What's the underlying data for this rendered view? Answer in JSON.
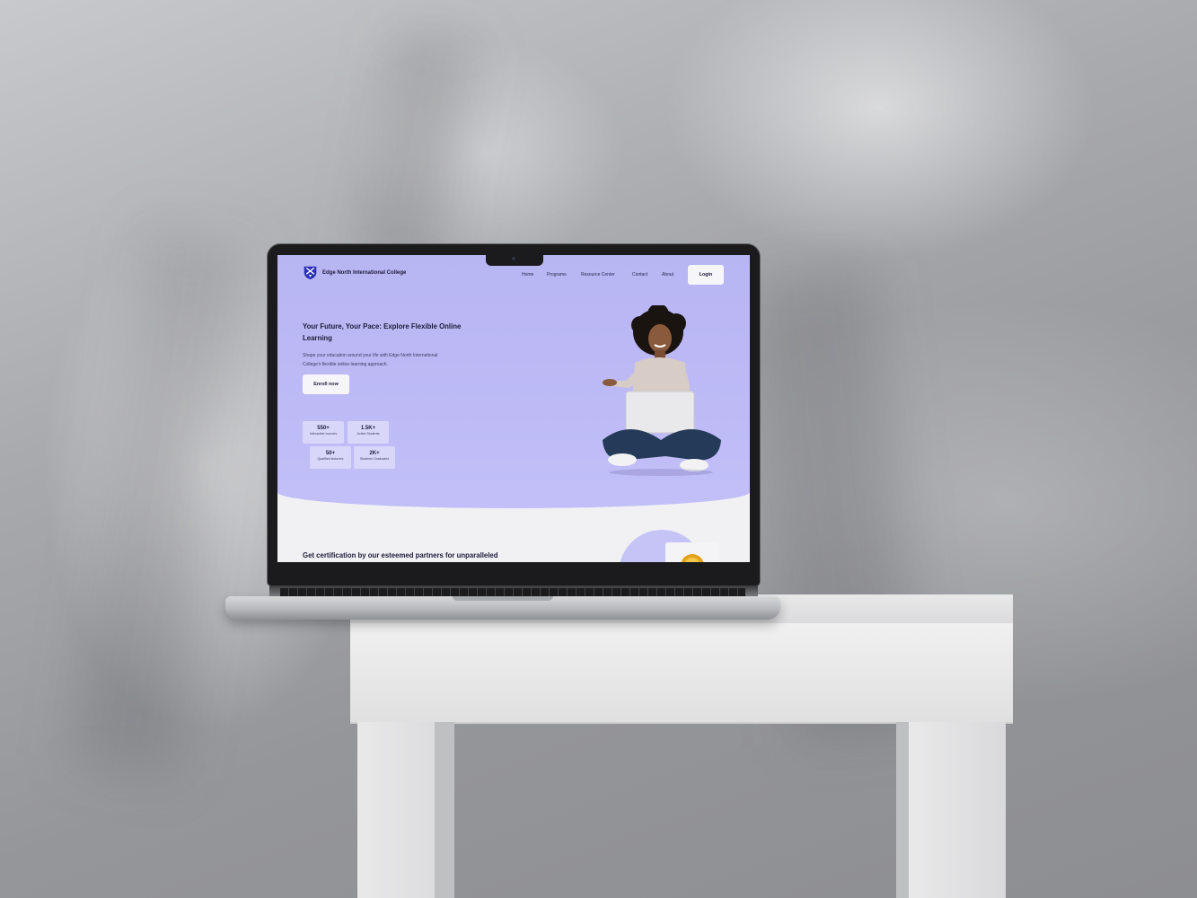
{
  "site": {
    "brand": "Edge North International College",
    "nav": {
      "items": [
        "Home",
        "Programs",
        "Resource Center",
        "Contact",
        "About"
      ],
      "login_label": "Login"
    },
    "hero": {
      "title": "Your Future, Your Pace: Explore Flexible Online Learning",
      "subtitle": "Shape your education around your life with Edge North International College's flexible online learning approach.",
      "cta_label": "Enroll now"
    },
    "stats": [
      {
        "value": "550+",
        "label": "Interactive courses"
      },
      {
        "value": "1.5K+",
        "label": "Active Students"
      },
      {
        "value": "50+",
        "label": "Qualified lecturers"
      },
      {
        "value": "2K+",
        "label": "Students Graduated"
      }
    ],
    "certification": {
      "title": "Get certification by our esteemed partners for unparalleled"
    }
  },
  "colors": {
    "hero_bg": "#bcb9f6",
    "brand_dark": "#1d1b3a",
    "logo_blue": "#2a2fb8",
    "button_bg": "#f6f6fa",
    "page_bg": "#f1f1f4"
  },
  "icons": {
    "logo": "shield-crest-icon",
    "illustration": "student-with-laptop-illustration",
    "badge": "gold-badge-icon"
  }
}
